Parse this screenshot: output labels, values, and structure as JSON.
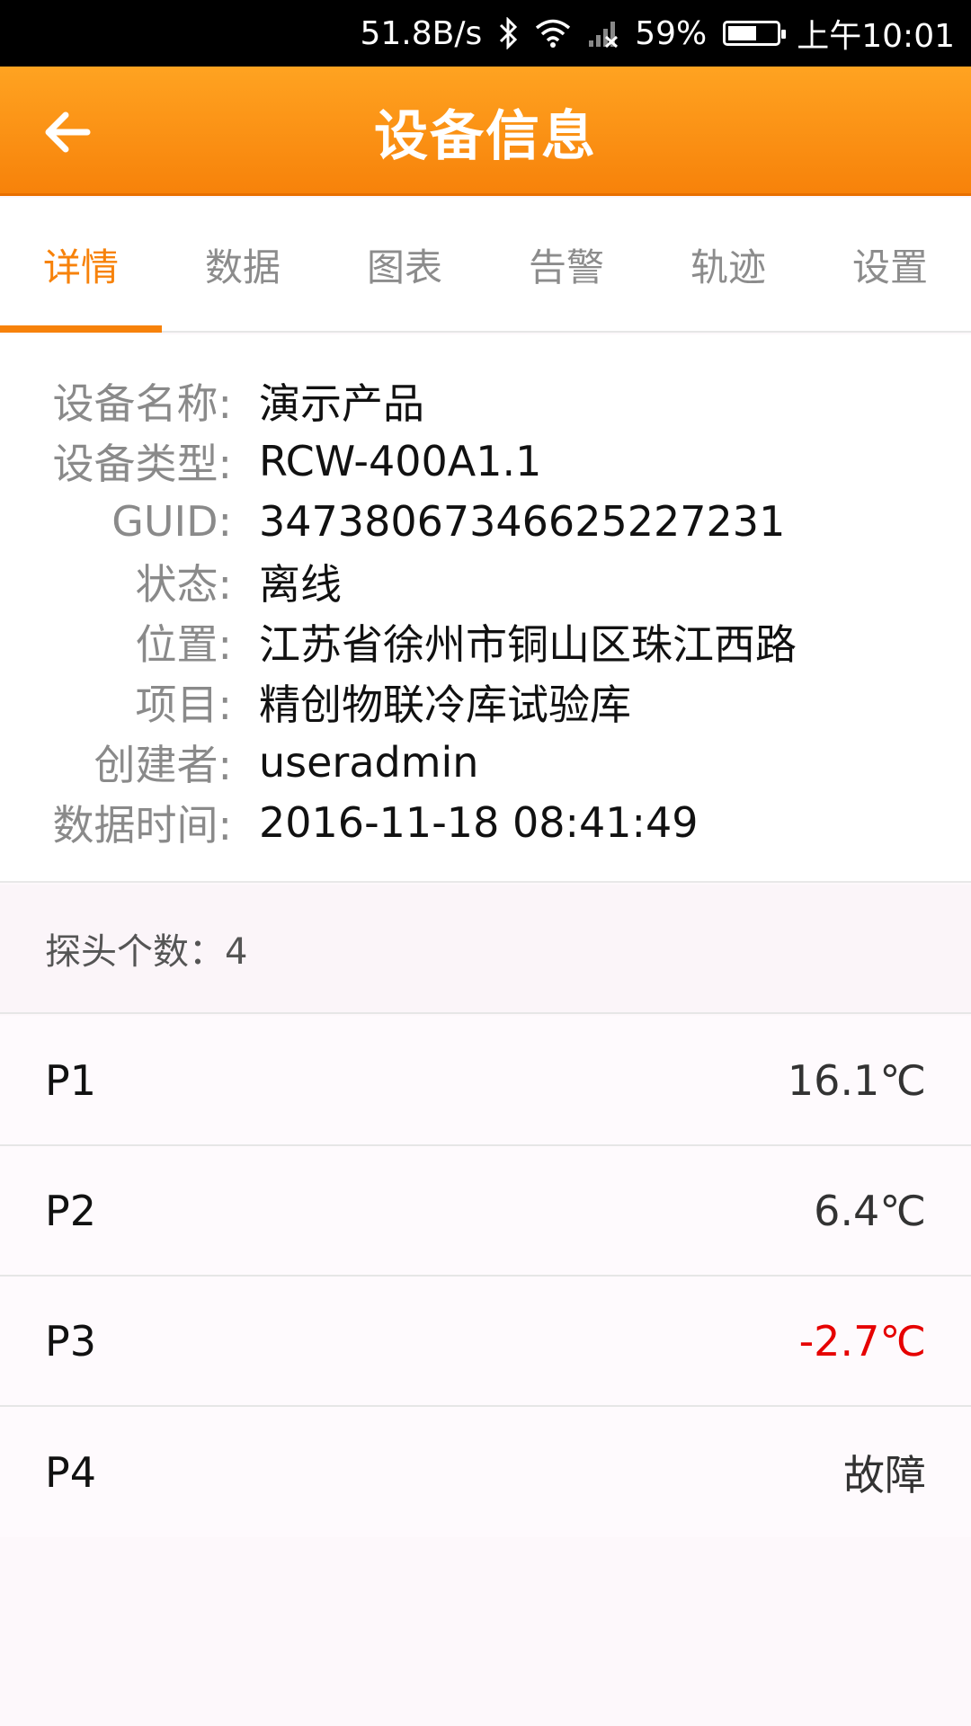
{
  "status_bar": {
    "net_speed": "51.8B/s",
    "battery_percent": "59%",
    "battery_level": 0.59,
    "time": "上午10:01",
    "icons": [
      "bluetooth-icon",
      "wifi-icon",
      "signal-icon"
    ]
  },
  "app_bar": {
    "title": "设备信息",
    "back_icon": "arrow-left-icon"
  },
  "tabs": [
    {
      "label": "详情",
      "active": true
    },
    {
      "label": "数据",
      "active": false
    },
    {
      "label": "图表",
      "active": false
    },
    {
      "label": "告警",
      "active": false
    },
    {
      "label": "轨迹",
      "active": false
    },
    {
      "label": "设置",
      "active": false
    }
  ],
  "details": [
    {
      "label": "设备名称:",
      "value": "演示产品"
    },
    {
      "label": "设备类型:",
      "value": "RCW-400A1.1"
    },
    {
      "label": "GUID:",
      "value": "3473806734662522​7231"
    },
    {
      "label": "状态:",
      "value": "离线"
    },
    {
      "label": "位置:",
      "value": "江苏省徐州市铜山区珠江西路"
    },
    {
      "label": "项目:",
      "value": "精创物联冷库试验库"
    },
    {
      "label": "创建者:",
      "value": "useradmin"
    },
    {
      "label": "数据时间:",
      "value": "2016-11-18 08:41:49"
    }
  ],
  "probe_count": "探头个数：4",
  "probes": [
    {
      "name": "P1",
      "value": "16.1℃",
      "alert": false
    },
    {
      "name": "P2",
      "value": "6.4℃",
      "alert": false
    },
    {
      "name": "P3",
      "value": "-2.7℃",
      "alert": true
    },
    {
      "name": "P4",
      "value": "故障",
      "alert": false
    }
  ],
  "colors": {
    "accent": "#f7820a",
    "alert": "#e60000"
  }
}
